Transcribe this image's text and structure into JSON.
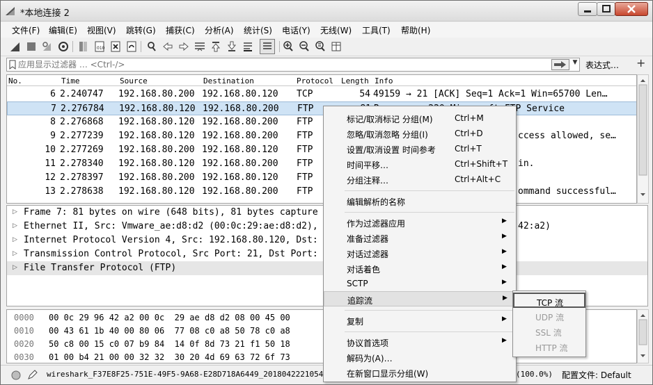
{
  "window": {
    "title": "*本地连接 2"
  },
  "menu": [
    "文件(F)",
    "编辑(E)",
    "视图(V)",
    "跳转(G)",
    "捕获(C)",
    "分析(A)",
    "统计(S)",
    "电话(Y)",
    "无线(W)",
    "工具(T)",
    "帮助(H)"
  ],
  "filter": {
    "placeholder": "应用显示过滤器 … <Ctrl-/>",
    "expression_label": "表达式…",
    "plus": "+"
  },
  "packet_list": {
    "columns": [
      "No.",
      "Time",
      "Source",
      "Destination",
      "Protocol",
      "Length",
      "Info"
    ],
    "rows": [
      {
        "no": "6",
        "time": "2.240747",
        "source": "192.168.80.200",
        "destination": "192.168.80.120",
        "protocol": "TCP",
        "length": "54",
        "info": "49159 → 21 [ACK] Seq=1 Ack=1 Win=65700 Len…"
      },
      {
        "no": "7",
        "time": "2.276784",
        "source": "192.168.80.120",
        "destination": "192.168.80.200",
        "protocol": "FTP",
        "length": "81",
        "info": "Response: 220 Microsoft FTP Service"
      },
      {
        "no": "8",
        "time": "2.276868",
        "source": "192.168.80.120",
        "destination": "192.168.80.200",
        "protocol": "FTP",
        "length": "",
        "info": ""
      },
      {
        "no": "9",
        "time": "2.277239",
        "source": "192.168.80.120",
        "destination": "192.168.80.200",
        "protocol": "FTP",
        "length": "",
        "info": "ccess allowed, se…"
      },
      {
        "no": "10",
        "time": "2.277269",
        "source": "192.168.80.200",
        "destination": "192.168.80.120",
        "protocol": "FTP",
        "length": "",
        "info": ""
      },
      {
        "no": "11",
        "time": "2.278340",
        "source": "192.168.80.120",
        "destination": "192.168.80.200",
        "protocol": "FTP",
        "length": "",
        "info": "in."
      },
      {
        "no": "12",
        "time": "2.278397",
        "source": "192.168.80.200",
        "destination": "192.168.80.120",
        "protocol": "FTP",
        "length": "",
        "info": ""
      },
      {
        "no": "13",
        "time": "2.278638",
        "source": "192.168.80.120",
        "destination": "192.168.80.200",
        "protocol": "FTP",
        "length": "",
        "info": "ommand successful…"
      }
    ]
  },
  "details": [
    "Frame 7: 81 bytes on wire (648 bits), 81 bytes capture",
    "Ethernet II, Src: Vmware_ae:d8:d2 (00:0c:29:ae:d8:d2),",
    "Internet Protocol Version 4, Src: 192.168.80.120, Dst:",
    "Transmission Control Protocol, Src Port: 21, Dst Port:",
    "File Transfer Protocol (FTP)"
  ],
  "details_right": "42:a2)",
  "bytes": [
    {
      "offset": "0000",
      "hex": "00 0c 29 96 42 a2 00 0c  29 ae d8 d2 08 00 45 00"
    },
    {
      "offset": "0010",
      "hex": "00 43 61 1b 40 00 80 06  77 08 c0 a8 50 78 c0 a8"
    },
    {
      "offset": "0020",
      "hex": "50 c8 00 15 c0 07 b9 84  14 0f 8d 73 21 f1 50 18"
    },
    {
      "offset": "0030",
      "hex": "01 00 b4 21 00 00 32 32  30 20 4d 69 63 72 6f 73"
    }
  ],
  "status": {
    "file": "wireshark_F37E8F25-751E-49F5-9A68-E28D718A6449_20180422210546_a016",
    "pct": "(100.0%)",
    "profile": "配置文件: Default"
  },
  "context_menu": {
    "items": [
      {
        "label": "标记/取消标记 分组(M)",
        "shortcut": "Ctrl+M"
      },
      {
        "label": "忽略/取消忽略 分组(I)",
        "shortcut": "Ctrl+D"
      },
      {
        "label": "设置/取消设置 时间参考",
        "shortcut": "Ctrl+T"
      },
      {
        "label": "时间平移…",
        "shortcut": "Ctrl+Shift+T"
      },
      {
        "label": "分组注释…",
        "shortcut": "Ctrl+Alt+C"
      },
      {
        "label": "编辑解析的名称",
        "shortcut": ""
      },
      {
        "label": "作为过滤器应用",
        "shortcut": ""
      },
      {
        "label": "准备过滤器",
        "shortcut": ""
      },
      {
        "label": "对话过滤器",
        "shortcut": ""
      },
      {
        "label": "对话着色",
        "shortcut": ""
      },
      {
        "label": "SCTP",
        "shortcut": ""
      },
      {
        "label": "追踪流",
        "shortcut": ""
      },
      {
        "label": "复制",
        "shortcut": ""
      },
      {
        "label": "协议首选项",
        "shortcut": ""
      },
      {
        "label": "解码为(A)…",
        "shortcut": ""
      },
      {
        "label": "在新窗口显示分组(W)",
        "shortcut": ""
      }
    ],
    "submenu_arrow": "▶"
  },
  "follow_submenu": [
    "TCP 流",
    "UDP 流",
    "SSL 流",
    "HTTP 流"
  ],
  "colors": {
    "selected_row": "#cfe3f5",
    "menu_bg": "#f4f4f4"
  }
}
